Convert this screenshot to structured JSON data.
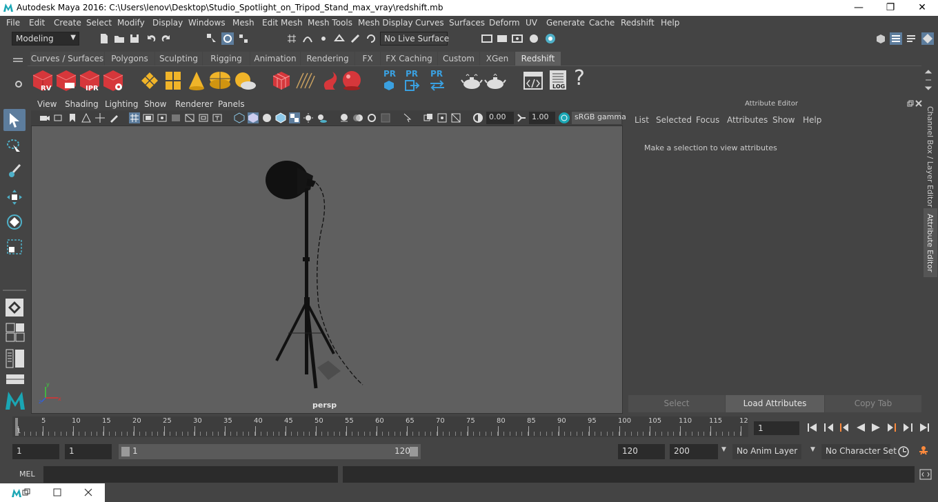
{
  "window": {
    "title": "Autodesk Maya 2016: C:\\Users\\lenov\\Desktop\\Studio_Spotlight_on_Tripod_Stand_max_vray\\redshift.mb",
    "minimize_glyph": "—",
    "maximize_glyph": "❐",
    "close_glyph": "✕"
  },
  "menubar": [
    "File",
    "Edit",
    "Create",
    "Select",
    "Modify",
    "Display",
    "Windows",
    "Mesh",
    "Edit Mesh",
    "Mesh Tools",
    "Mesh Display",
    "Curves",
    "Surfaces",
    "Deform",
    "UV",
    "Generate",
    "Cache",
    "Redshift",
    "Help"
  ],
  "statusline": {
    "mode": "Modeling",
    "live_surface": "No Live Surface"
  },
  "shelf_tabs": [
    "Curves / Surfaces",
    "Polygons",
    "Sculpting",
    "Rigging",
    "Animation",
    "Rendering",
    "FX",
    "FX Caching",
    "Custom",
    "XGen",
    "Redshift"
  ],
  "shelf_active_tab": "Redshift",
  "shelf_labels": {
    "rv": "RV",
    "ipr": "IPR",
    "pr1": "PR",
    "pr2": "PR",
    "pr3": "PR",
    "log": "LOG",
    "help": "?"
  },
  "viewport": {
    "menu": [
      "View",
      "Shading",
      "Lighting",
      "Show",
      "Renderer",
      "Panels"
    ],
    "exposure": "0.00",
    "gamma": "1.00",
    "color_space": "sRGB gamma",
    "camera_label": "persp",
    "axis_x": "x",
    "axis_y": "y",
    "axis_z": "z"
  },
  "attribute_editor": {
    "title": "Attribute Editor",
    "menu": [
      "List",
      "Selected",
      "Focus",
      "Attributes",
      "Show",
      "Help"
    ],
    "message": "Make a selection to view attributes",
    "buttons": {
      "select": "Select",
      "load": "Load Attributes",
      "copy": "Copy Tab"
    }
  },
  "side_tabs": {
    "channel_box": "Channel Box / Layer Editor",
    "attribute_editor": "Attribute Editor"
  },
  "timeline": {
    "ticks": [
      "1",
      "5",
      "10",
      "15",
      "20",
      "25",
      "30",
      "35",
      "40",
      "45",
      "50",
      "55",
      "60",
      "65",
      "70",
      "75",
      "80",
      "85",
      "90",
      "95",
      "100",
      "105",
      "110",
      "115",
      "12"
    ],
    "current_frame": "1"
  },
  "range": {
    "start": "1",
    "playback_start": "1",
    "slider_start": "1",
    "slider_end": "120",
    "playback_end": "120",
    "end": "200",
    "anim_layer": "No Anim Layer",
    "character_set": "No Character Set"
  },
  "cmdline": {
    "language": "MEL"
  },
  "colors": {
    "accent": "#5d7d9d",
    "redshift_red": "#d6373b",
    "yellow": "#f0b429",
    "pr_blue": "#3aa0e0"
  }
}
